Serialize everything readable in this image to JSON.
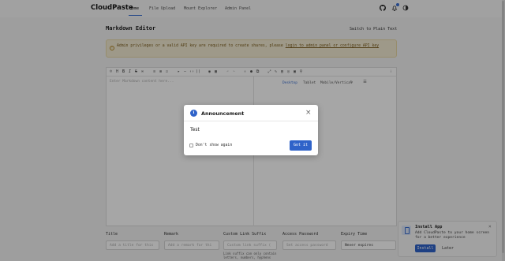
{
  "app": {
    "brand": "CloudPaste"
  },
  "nav": {
    "links": [
      "Home",
      "File Upload",
      "Mount Explorer",
      "Admin Panel"
    ],
    "active": "Home",
    "icons": [
      "github-icon",
      "notification-icon",
      "theme-toggle-icon"
    ]
  },
  "page": {
    "title": "Markdown Editor",
    "switch_label": "Switch to Plain Text"
  },
  "warning": {
    "text": "Admin privileges or a valid API key are required to create shares, please ",
    "link": "login to admin panel or configure API key"
  },
  "editor": {
    "placeholder": "Enter Markdown content here...",
    "preview_tabs": [
      "Desktop",
      "Tablet",
      "Mobile/Vertical"
    ],
    "active_preview": "Desktop"
  },
  "form": {
    "title": {
      "label": "Title",
      "placeholder": "Add a title for this"
    },
    "remark": {
      "label": "Remark",
      "placeholder": "Add a remark for thi"
    },
    "custom_link": {
      "label": "Custom Link Suffix",
      "placeholder": "Custom link suffix (",
      "help": "Link suffix can only contain letters, numbers, hyphens"
    },
    "password": {
      "label": "Access Password",
      "placeholder": "Set access password"
    },
    "expiry": {
      "label": "Expiry Time",
      "value": "Never expires"
    }
  },
  "install_prompt": {
    "title": "Install App",
    "text": "Add CloudPaste to your home screen for a better experience",
    "install_label": "Install",
    "later_label": "Later"
  },
  "modal": {
    "title": "Announcement",
    "body": "Test",
    "checkbox_label": "Don't show again",
    "confirm_label": "Got it"
  }
}
